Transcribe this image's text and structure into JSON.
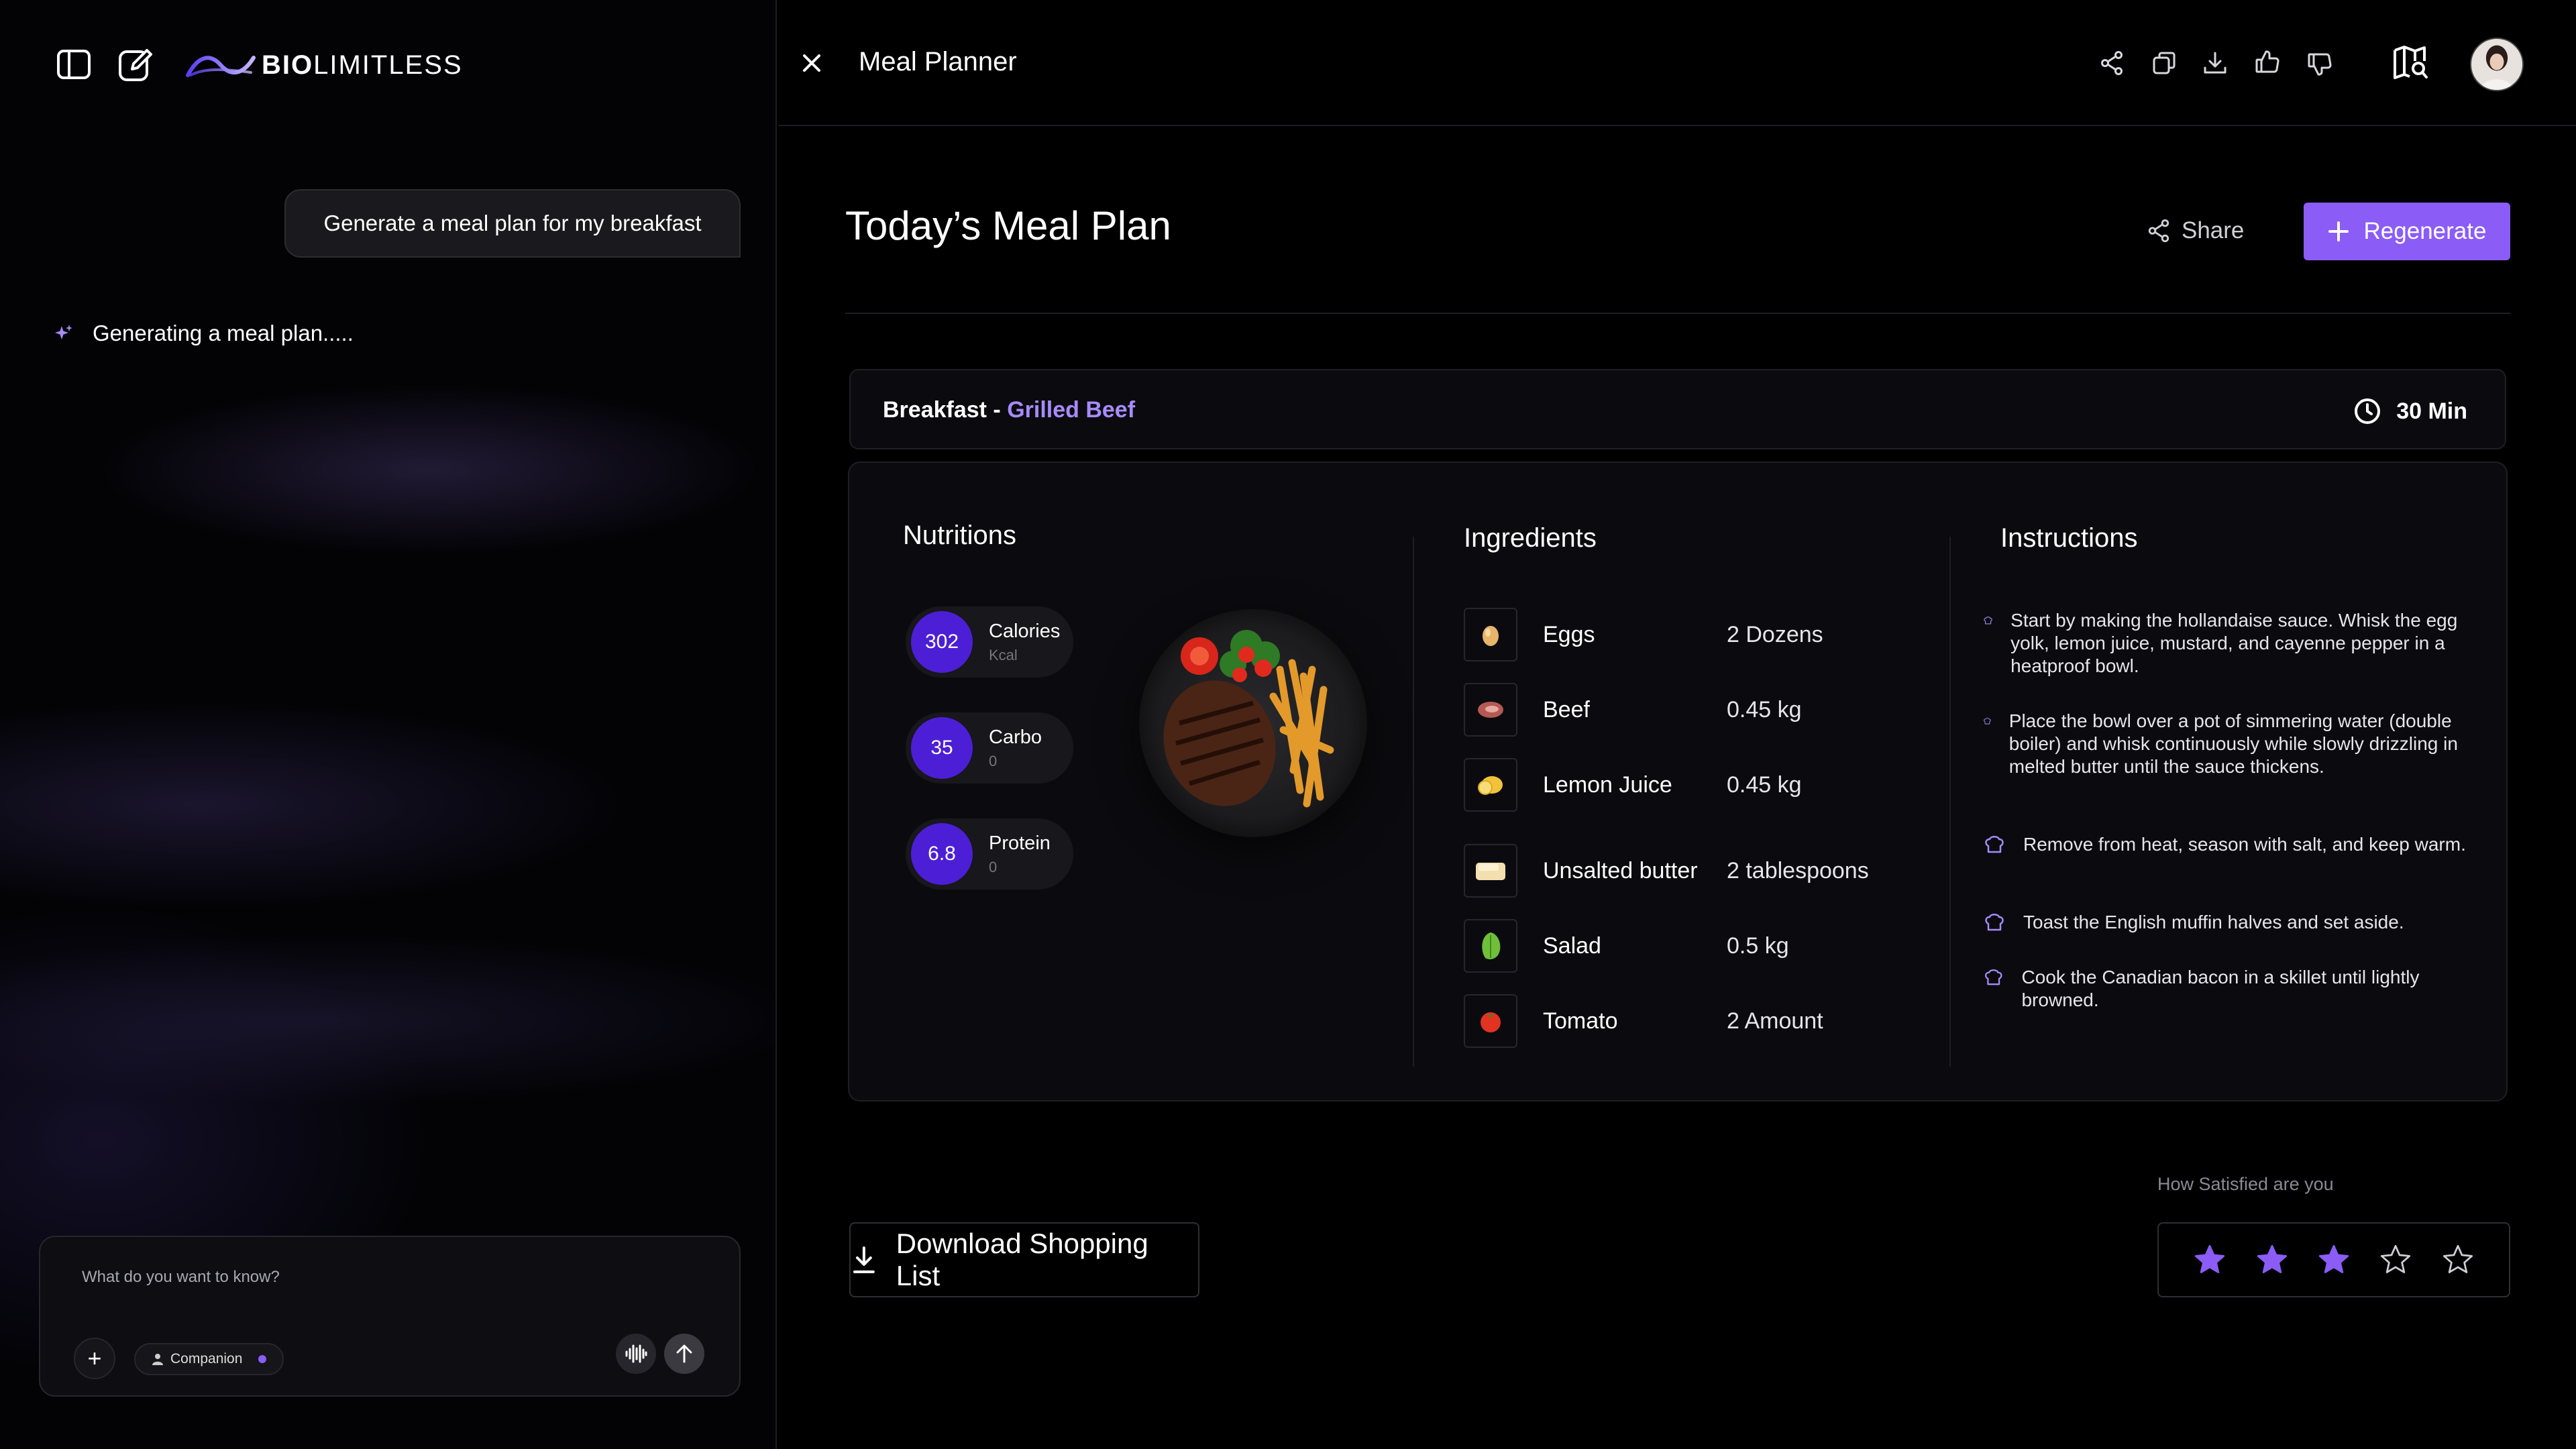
{
  "brand": {
    "logo_bold": "BIO",
    "logo_light": "LIMITLESS"
  },
  "chat": {
    "user_message": "Generate a meal plan for my breakfast",
    "status_message": "Generating a meal plan.....",
    "input_placeholder": "What do you want to know?",
    "mode_chip": "Companion"
  },
  "panel": {
    "title": "Meal Planner"
  },
  "plan": {
    "page_title": "Today’s Meal Plan",
    "share_label": "Share",
    "regenerate_label": "Regenerate",
    "meal_type": "Breakfast - ",
    "meal_name": "Grilled Beef",
    "duration": "30 Min"
  },
  "nutritions": {
    "title": "Nutritions",
    "items": [
      {
        "value": "302",
        "name": "Calories",
        "unit": "Kcal"
      },
      {
        "value": "35",
        "name": "Carbo",
        "unit": "0"
      },
      {
        "value": "6.8",
        "name": "Protein",
        "unit": "0"
      }
    ]
  },
  "ingredients": {
    "title": "Ingredients",
    "items": [
      {
        "name": "Eggs",
        "qty": "2 Dozens",
        "icon": "egg-icon"
      },
      {
        "name": "Beef",
        "qty": "0.45 kg",
        "icon": "beef-icon"
      },
      {
        "name": "Lemon Juice",
        "qty": "0.45 kg",
        "icon": "lemon-icon"
      },
      {
        "name": "Unsalted butter",
        "qty": "2 tablespoons",
        "icon": "butter-icon"
      },
      {
        "name": "Salad",
        "qty": "0.5 kg",
        "icon": "salad-icon"
      },
      {
        "name": "Tomato",
        "qty": "2 Amount",
        "icon": "tomato-icon"
      }
    ]
  },
  "instructions": {
    "title": "Instructions",
    "steps": [
      "Start by making the hollandaise sauce. Whisk the egg yolk, lemon juice, mustard, and cayenne pepper in a heatproof bowl.",
      "Place the bowl over a pot of simmering water (double boiler) and whisk continuously while slowly drizzling in melted butter until the sauce thickens.",
      "Remove from heat, season with salt, and keep warm.",
      "Toast the English muffin halves and set aside.",
      "Cook the Canadian bacon in a skillet until lightly browned."
    ]
  },
  "footer": {
    "download_label": "Download Shopping List",
    "satisfaction_label": "How Satisfied are you",
    "rating": 3,
    "rating_max": 5
  },
  "colors": {
    "accent": "#8b5cf6",
    "accent_text": "#a78bfa",
    "nutrient_circle": "#4c1fd6"
  }
}
